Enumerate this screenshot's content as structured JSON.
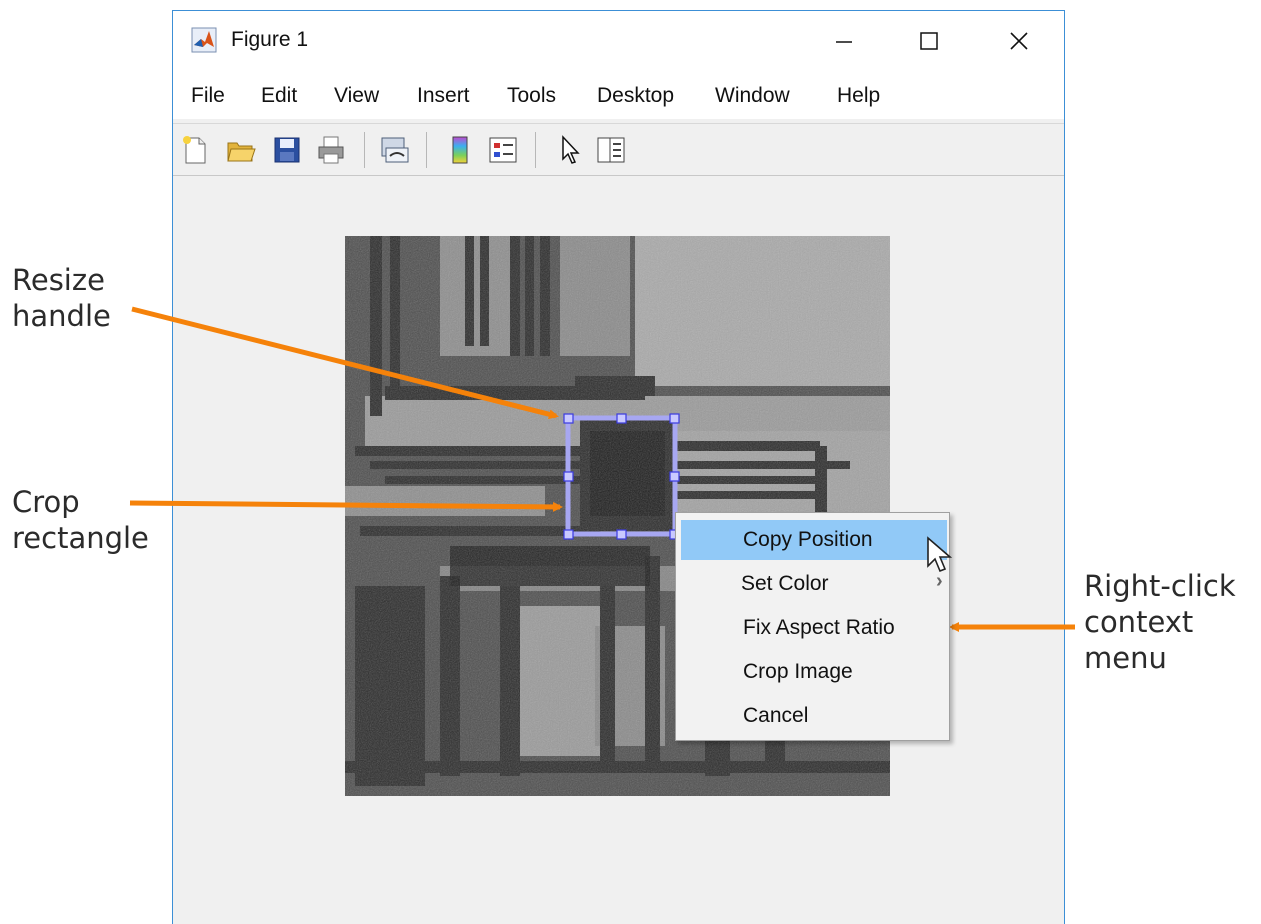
{
  "window": {
    "title": "Figure 1",
    "minimize_glyph": "—",
    "maximize_glyph": "☐",
    "close_glyph": "✕",
    "app_icon": "matlab-logo-icon"
  },
  "menubar": {
    "items": [
      "File",
      "Edit",
      "View",
      "Insert",
      "Tools",
      "Desktop",
      "Window",
      "Help"
    ],
    "dock_glyph": "➘"
  },
  "toolbar": {
    "icons": [
      "new-figure-icon",
      "open-file-icon",
      "save-icon",
      "print-icon",
      "link-plot-icon",
      "colorbar-icon",
      "legend-icon",
      "edit-plot-pointer-icon",
      "property-inspector-icon"
    ]
  },
  "context_menu": {
    "items": [
      "Copy Position",
      "Set Color",
      "Fix Aspect Ratio",
      "Crop Image",
      "Cancel"
    ],
    "highlighted": "Copy Position",
    "submenu_glyph": "›"
  },
  "annotations": {
    "resize_handle": [
      "Resize",
      "handle"
    ],
    "crop_rectangle": [
      "Crop",
      "rectangle"
    ],
    "context_menu": [
      "Right-click",
      "context",
      "menu"
    ]
  },
  "colors": {
    "window_border": "#3c8fd6",
    "arrow": "#f5820a",
    "crop_rect": "#a7a7f2",
    "highlight": "#91c9f7"
  }
}
